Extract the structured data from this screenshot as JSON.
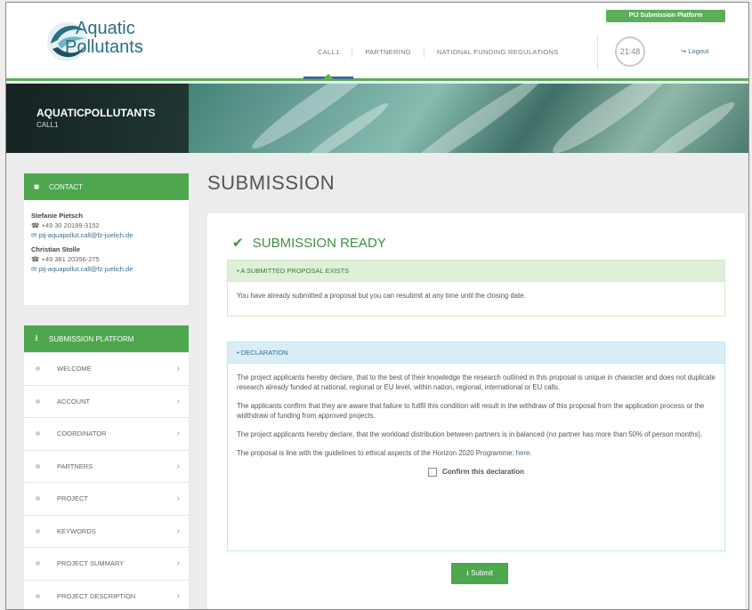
{
  "header": {
    "brand_line1": "Aquatic",
    "brand_line2": "Pollutants",
    "platform_badge": "PtJ Submission Platform",
    "nav": [
      "CALL1",
      "PARTNERING",
      "NATIONAL FUNDING REGULATIONS"
    ],
    "timer": "21:48",
    "logout": "Logout"
  },
  "banner": {
    "title": "AQUATICPOLLUTANTS",
    "subtitle": "CALL1"
  },
  "contact": {
    "heading": "CONTACT",
    "people": [
      {
        "name": "Stefanie Pietsch",
        "phone": "+49 30 20199-3152",
        "email": "ptj-aquapollut.call@fz-juelich.de"
      },
      {
        "name": "Christian Stolle",
        "phone": "+49 381 20356-275",
        "email": "ptj-aquapollut.call@fz-juelich.de"
      }
    ]
  },
  "sidebar": {
    "heading": "SUBMISSION PLATFORM",
    "items": [
      "WELCOME",
      "ACCOUNT",
      "COORDINATOR",
      "PARTNERS",
      "PROJECT",
      "KEYWORDS",
      "PROJECT SUMMARY",
      "PROJECT DESCRIPTION"
    ]
  },
  "main": {
    "page_title": "SUBMISSION",
    "ready_title": "SUBMISSION READY",
    "submitted_panel": {
      "heading": "A SUBMITTED PROPOSAL EXISTS",
      "text": "You have already submitted a proposal but you can resubmit at any time until the closing date."
    },
    "declaration_panel": {
      "heading": "DECLARATION",
      "p1": "The project applicants hereby declare, that to the best of their knowledge the research outlined in this proposal is unique in character and does not duplicate research already funded at national, regional or EU level, within nation, regional, international or EU calls.",
      "p2": "The applicants confirm that they are aware that failure to fullfil this condition will result in the withdraw of this proposal from the application process or the widthdraw of funding from approved projects.",
      "p3": "The project applicants hereby declare, that the workload distribution between partners is in balanced (no partner has more than 50% of person months).",
      "p4_prefix": "The proposal is line with the guidelines to ethical aspects of the Horizon 2020 Programme: ",
      "p4_link": "here.",
      "confirm_label": "Confirm this declaration"
    },
    "submit_label": "Submit"
  },
  "colors": {
    "accent_green": "#4ea64e",
    "link_blue": "#3b6d8c",
    "success_text": "#3f8f3f"
  }
}
